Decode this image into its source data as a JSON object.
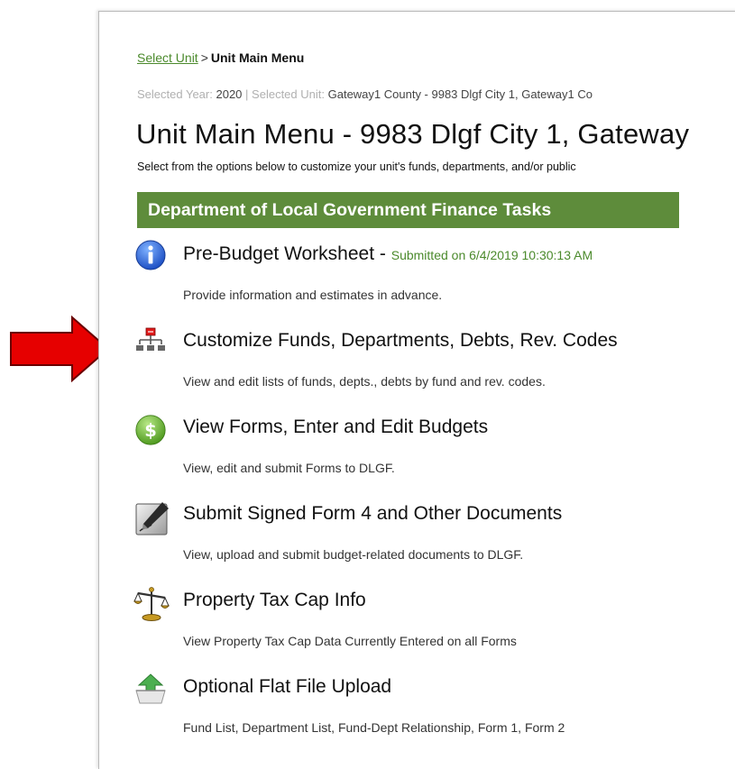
{
  "breadcrumb": {
    "link": "Select Unit",
    "separator": ">",
    "current": "Unit Main Menu"
  },
  "selection": {
    "year_label": "Selected Year:",
    "year_value": "2020",
    "divider": "|",
    "unit_label": "Selected Unit:",
    "unit_value": "Gateway1 County - 9983 Dlgf City 1, Gateway1 Co"
  },
  "page": {
    "title": "Unit Main Menu - 9983 Dlgf City 1, Gateway",
    "subtitle": "Select from the options below to customize your unit's funds, departments, and/or public"
  },
  "section": {
    "header": "Department of Local Government Finance Tasks"
  },
  "tasks": [
    {
      "title": "Pre-Budget Worksheet",
      "status_sep": " - ",
      "status": "Submitted on 6/4/2019 10:30:13 AM",
      "desc": "Provide information and estimates in advance.",
      "icon": "info-icon"
    },
    {
      "title": "Customize Funds, Departments, Debts, Rev. Codes",
      "desc": "View and edit lists of funds, depts., debts by fund and rev. codes.",
      "icon": "org-chart-icon"
    },
    {
      "title": "View Forms, Enter and Edit Budgets",
      "desc": "View, edit and submit Forms to DLGF.",
      "icon": "dollar-icon"
    },
    {
      "title": "Submit Signed Form 4 and Other Documents",
      "desc": "View, upload and submit budget-related documents to DLGF.",
      "icon": "pen-signature-icon"
    },
    {
      "title": "Property Tax Cap Info",
      "desc": "View Property Tax Cap Data Currently Entered on all Forms",
      "icon": "scales-icon"
    },
    {
      "title": "Optional Flat File Upload",
      "desc": "Fund List, Department List, Fund-Dept Relationship, Form 1, Form 2",
      "icon": "upload-box-icon"
    }
  ],
  "colors": {
    "accent_green": "#5e8c3b",
    "link_green": "#4b8a2c",
    "arrow_red": "#e60000"
  }
}
